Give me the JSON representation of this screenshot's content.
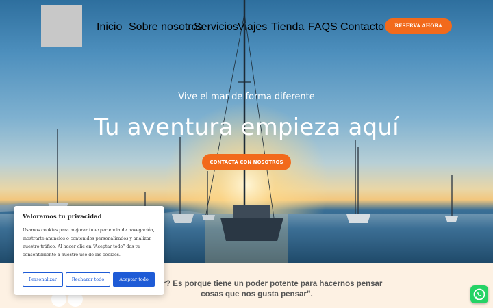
{
  "nav": {
    "items": [
      {
        "label": "Inicio"
      },
      {
        "label": "Sobre nosotros"
      },
      {
        "label": "Servicios"
      },
      {
        "label": "Viajes"
      },
      {
        "label": "Tienda"
      },
      {
        "label": "FAQS"
      },
      {
        "label": "Contacto"
      }
    ],
    "cta_label": "RESERVA AHORA"
  },
  "hero": {
    "tagline": "Vive el mar de forma diferente",
    "headline": "Tu aventura empieza aquí",
    "cta_label": "CONTACTA CON NOSOTROS"
  },
  "quote": {
    "text": "os el mar? Es porque tiene un poder potente para hacernos pensar cosas que nos gusta pensar”."
  },
  "cookie_banner": {
    "title": "Valoramos tu privacidad",
    "body": "Usamos cookies para mejorar tu experiencia de navegación, mostrarte anuncios o contenidos personalizados y analizar nuestro tráfico. Al hacer clic en “Aceptar todo” das tu consentimiento a nuestro uso de las cookies.",
    "customize_label": "Personalizar",
    "reject_label": "Rechazar todo",
    "accept_label": "Aceptar todo"
  },
  "colors": {
    "accent_orange": "#f26a1b",
    "cookie_blue": "#1e5bd6",
    "whatsapp_green": "#25d366"
  },
  "icons": {
    "whatsapp": "whatsapp-icon",
    "logo": "site-logo"
  }
}
